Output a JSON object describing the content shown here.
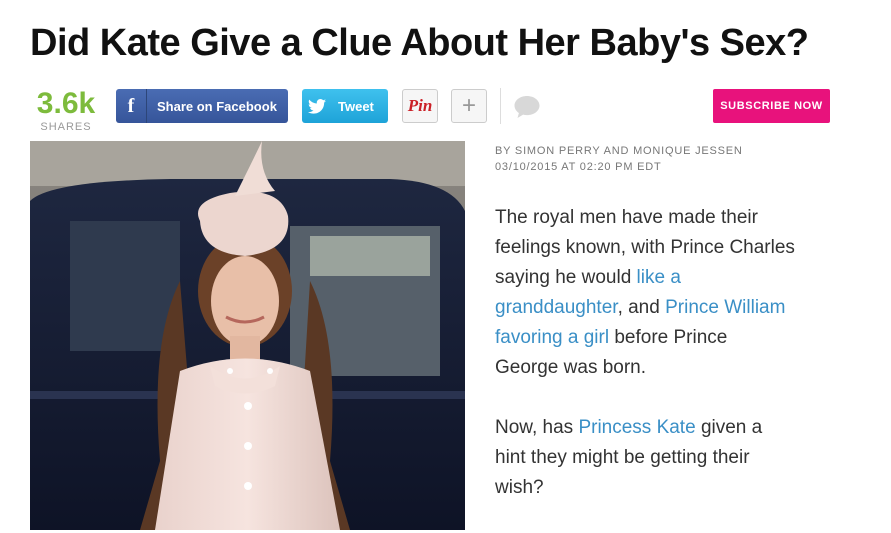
{
  "article": {
    "title": "Did Kate Give a Clue About Her Baby's Sex?",
    "byline": "BY SIMON PERRY AND MONIQUE JESSEN",
    "date": "03/10/2015 AT 02:20 PM EDT",
    "p1_a": "The royal men have made their feelings known, with Prince Charles saying he would ",
    "p1_link1": "like a granddaughter",
    "p1_b": ", and ",
    "p1_link2": "Prince William favoring a girl",
    "p1_c": " before Prince George was born.",
    "p2_a": "Now, has ",
    "p2_link": "Princess Kate",
    "p2_b": " given a hint they might be getting their wish?"
  },
  "share": {
    "count": "3.6k",
    "count_label": "SHARES",
    "facebook_label": "Share on Facebook",
    "facebook_icon": "f",
    "twitter_label": "Tweet",
    "pinterest_label": "Pin",
    "plus_label": "+",
    "subscribe_label": "SUBSCRIBE NOW"
  },
  "colors": {
    "shares": "#7dbb3c",
    "facebook": "#3b5998",
    "twitter": "#2aa9e0",
    "subscribe": "#e8127c",
    "link": "#3a8fc6"
  }
}
